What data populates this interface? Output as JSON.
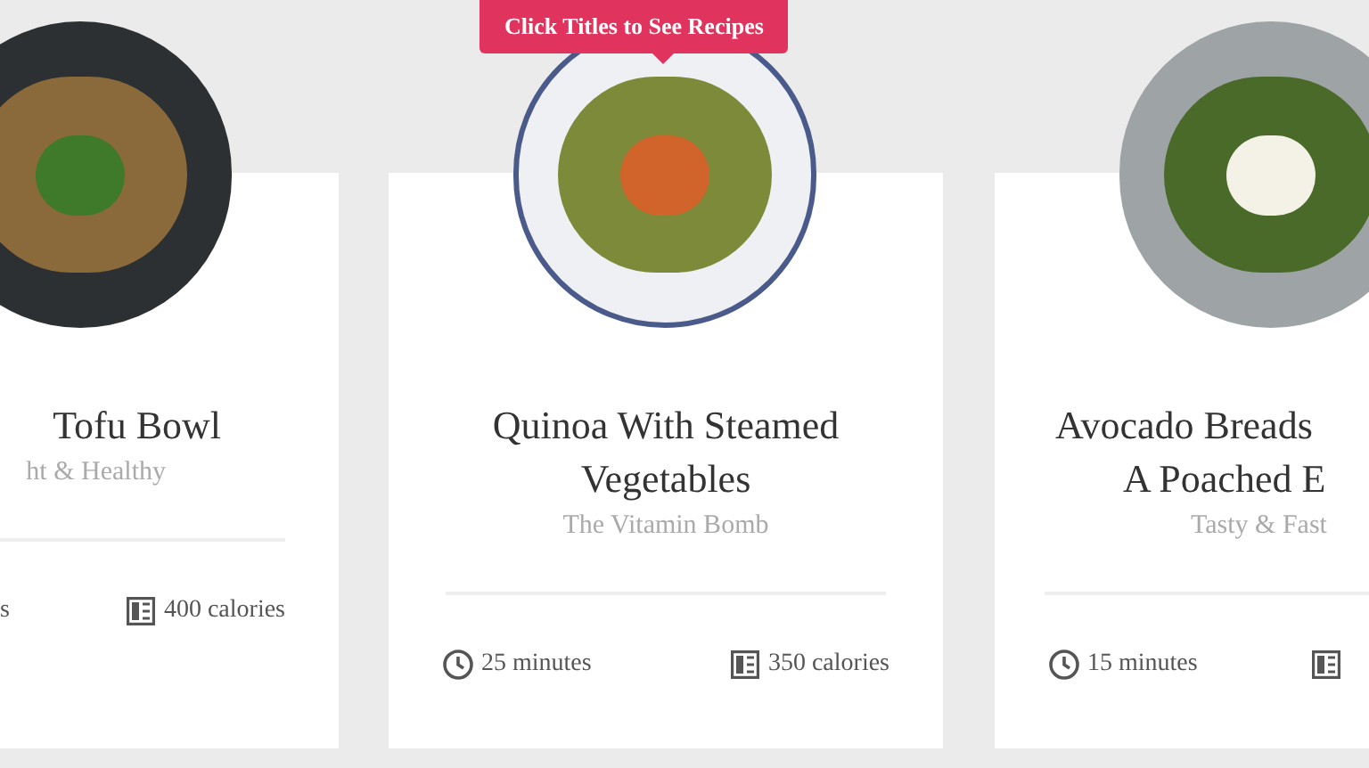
{
  "tooltip": {
    "text": "Click Titles to See Recipes"
  },
  "cards": [
    {
      "kind": "left",
      "title_lines": [
        "Tofu Bowl"
      ],
      "subtitle": "ht & Healthy",
      "time": "s",
      "calories": "400 calories"
    },
    {
      "kind": "center",
      "title_lines": [
        "Quinoa With Steamed",
        "Vegetables"
      ],
      "subtitle": "The Vitamin Bomb",
      "time": "25 minutes",
      "calories": "350 calories"
    },
    {
      "kind": "right",
      "title_lines": [
        "Avocado Breads",
        "A Poached E"
      ],
      "subtitle": "Tasty & Fast",
      "time": "15 minutes"
    }
  ]
}
